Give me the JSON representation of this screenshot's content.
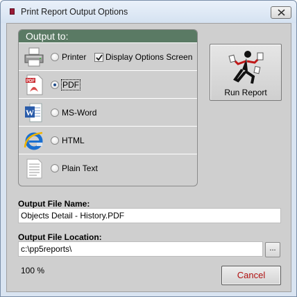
{
  "window": {
    "title": "Print Report Output Options"
  },
  "output_group": {
    "header": "Output to:",
    "options": [
      {
        "label": "Printer",
        "icon": "printer-icon",
        "selected": false
      },
      {
        "label": "PDF",
        "icon": "pdf-icon",
        "selected": true
      },
      {
        "label": "MS-Word",
        "icon": "word-icon",
        "selected": false
      },
      {
        "label": "HTML",
        "icon": "internet-explorer-icon",
        "selected": false
      },
      {
        "label": "Plain Text",
        "icon": "text-document-icon",
        "selected": false
      }
    ],
    "display_options": {
      "label": "Display Options Screen",
      "checked": true
    }
  },
  "run_report": {
    "label": "Run Report",
    "icon": "running-man-icon"
  },
  "output_file_name": {
    "label": "Output File Name:",
    "value": "Objects Detail - History.PDF"
  },
  "output_file_location": {
    "label": "Output File Location:",
    "value": "c:\\pp5reports\\",
    "browse_label": "..."
  },
  "progress_text": "100 %",
  "cancel_button": {
    "label": "Cancel"
  },
  "colors": {
    "group_header": "#5a7a64",
    "dialog_body": "#cfcfcf",
    "cancel_text": "#b01010"
  }
}
